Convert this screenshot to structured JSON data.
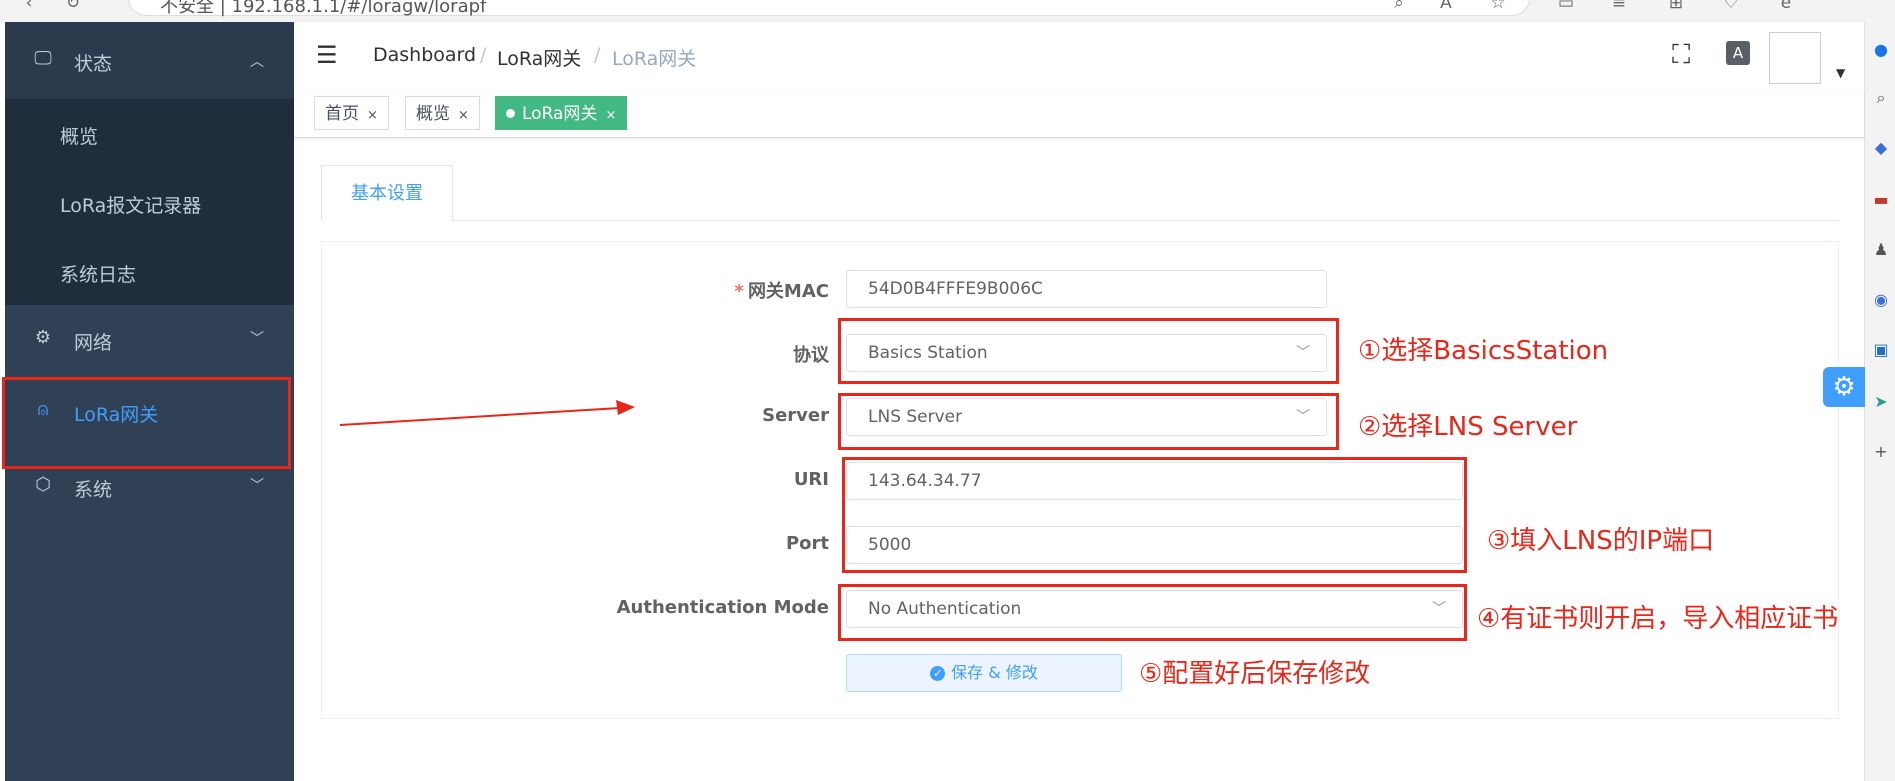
{
  "browser": {
    "url": "不安全 | 192.168.1.1/#/loragw/lorapf"
  },
  "sidebar": {
    "status_label": "状态",
    "status_items": [
      "概览",
      "LoRa报文记录器",
      "系统日志"
    ],
    "network_label": "网络",
    "lora_label": "LoRa网关",
    "system_label": "系统"
  },
  "header": {
    "breadcrumb": [
      "Dashboard",
      "LoRa网关",
      "LoRa网关"
    ],
    "separator": "/"
  },
  "tags": [
    {
      "label": "首页",
      "active": false
    },
    {
      "label": "概览",
      "active": false
    },
    {
      "label": "LoRa网关",
      "active": true
    }
  ],
  "tab": {
    "label": "基本设置"
  },
  "form": {
    "mac": {
      "label": "网关MAC",
      "required_mark": "*",
      "value": "54D0B4FFFE9B006C"
    },
    "protocol": {
      "label": "协议",
      "value": "Basics Station"
    },
    "server": {
      "label": "Server",
      "value": "LNS Server"
    },
    "uri": {
      "label": "URI",
      "value": "143.64.34.77"
    },
    "port": {
      "label": "Port",
      "value": "5000"
    },
    "auth": {
      "label": "Authentication Mode",
      "value": "No Authentication"
    },
    "save_label": "保存 & 修改"
  },
  "annotations": [
    "①选择BasicsStation",
    "②选择LNS Server",
    "③填入LNS的IP端口",
    "④有证书则开启，导入相应证书",
    "⑤配置好后保存修改"
  ],
  "colors": {
    "sidebar_bg": "#304156",
    "accent": "#409eff",
    "active_tag": "#42b983",
    "annotation_red": "#e8261a"
  }
}
